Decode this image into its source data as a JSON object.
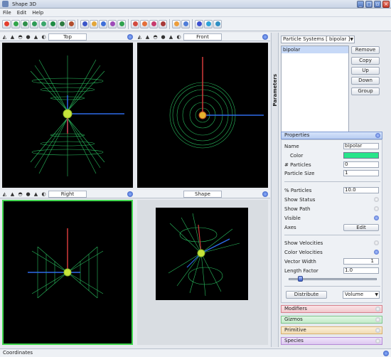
{
  "window": {
    "title": "Shape 3D"
  },
  "menu": [
    "File",
    "Edit",
    "Help"
  ],
  "toolbar_groups": [
    {
      "icons": [
        "#e33e2e",
        "#31a54a",
        "#2f8f4a",
        "#2d9b56",
        "#3aa66a",
        "#1f8c44",
        "#2c7a40",
        "#b24d2d"
      ]
    },
    {
      "icons": [
        "#3b56c8",
        "#e3a63a",
        "#3e6fd9",
        "#9e4ab8",
        "#2fa24e"
      ]
    },
    {
      "icons": [
        "#d24a3f",
        "#e46f3a",
        "#c73b6e",
        "#a83a3a"
      ]
    },
    {
      "icons": [
        "#ec9d3a",
        "#4f7dd8"
      ]
    },
    {
      "icons": [
        "#3c4fd0",
        "#2da3d8",
        "#2f8fc3"
      ]
    }
  ],
  "views": [
    {
      "label": "Top"
    },
    {
      "label": "Front"
    },
    {
      "label": "Right"
    },
    {
      "label": "Shape"
    }
  ],
  "params_tab": "Parameters",
  "particle_systems": {
    "select_label": "Particle Systems [ bipolar ]",
    "items": [
      "bipolar"
    ],
    "buttons": [
      "Remove",
      "Copy",
      "Up",
      "Down",
      "Group"
    ]
  },
  "properties": {
    "header": "Properties",
    "name_label": "Name",
    "name_value": "bipolar",
    "color_label": "Color",
    "color_value": "#27e58a",
    "particles_label": "# Particles",
    "particles_value": "0",
    "size_label": "Particle Size",
    "size_value": "1",
    "pct_label": "% Particles",
    "pct_value": "10.0",
    "show_status": "Show Status",
    "show_path": "Show Path",
    "visible": "Visible",
    "axes": "Axes",
    "edit": "Edit",
    "show_velocities": "Show Velocities",
    "color_velocities": "Color Velocities",
    "vector_width_label": "Vector Width",
    "vector_width_value": "1",
    "length_factor_label": "Length Factor",
    "length_factor_value": "1.0",
    "slider_value": 0.1,
    "distribute": "Distribute",
    "volume": "Volume"
  },
  "sections": [
    "Modifiers",
    "Gizmos",
    "Primitive",
    "Species"
  ],
  "status": "Coordinates"
}
